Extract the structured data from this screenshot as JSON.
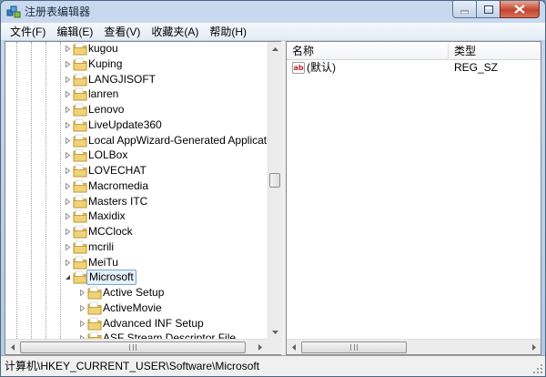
{
  "window": {
    "title": "注册表编辑器"
  },
  "menu": [
    "文件(F)",
    "编辑(E)",
    "查看(V)",
    "收藏夹(A)",
    "帮助(H)"
  ],
  "tree": {
    "nodes": [
      {
        "label": "kugou",
        "level": 1,
        "selected": false
      },
      {
        "label": "Kuping",
        "level": 1,
        "selected": false
      },
      {
        "label": "LANGJISOFT",
        "level": 1,
        "selected": false
      },
      {
        "label": "lanren",
        "level": 1,
        "selected": false
      },
      {
        "label": "Lenovo",
        "level": 1,
        "selected": false
      },
      {
        "label": "LiveUpdate360",
        "level": 1,
        "selected": false
      },
      {
        "label": "Local AppWizard-Generated Applications",
        "level": 1,
        "selected": false
      },
      {
        "label": "LOLBox",
        "level": 1,
        "selected": false
      },
      {
        "label": "LOVECHAT",
        "level": 1,
        "selected": false
      },
      {
        "label": "Macromedia",
        "level": 1,
        "selected": false
      },
      {
        "label": "Masters ITC",
        "level": 1,
        "selected": false
      },
      {
        "label": "Maxidix",
        "level": 1,
        "selected": false
      },
      {
        "label": "MCClock",
        "level": 1,
        "selected": false
      },
      {
        "label": "mcrili",
        "level": 1,
        "selected": false
      },
      {
        "label": "MeiTu",
        "level": 1,
        "selected": false
      },
      {
        "label": "Microsoft",
        "level": 1,
        "selected": true,
        "expanded": true
      },
      {
        "label": "Active Setup",
        "level": 2,
        "selected": false
      },
      {
        "label": "ActiveMovie",
        "level": 2,
        "selected": false
      },
      {
        "label": "Advanced INF Setup",
        "level": 2,
        "selected": false
      },
      {
        "label": "ASF Stream Descriptor File",
        "level": 2,
        "selected": false
      }
    ]
  },
  "list": {
    "columns": {
      "name": "名称",
      "type": "类型"
    },
    "rows": [
      {
        "name": "(默认)",
        "type": "REG_SZ",
        "icon": "string-value-icon"
      }
    ]
  },
  "status": {
    "path": "计算机\\HKEY_CURRENT_USER\\Software\\Microsoft"
  },
  "colors": {
    "folder": "#e8c25a",
    "selection": "#e3f0fc",
    "close": "#c4452c"
  }
}
